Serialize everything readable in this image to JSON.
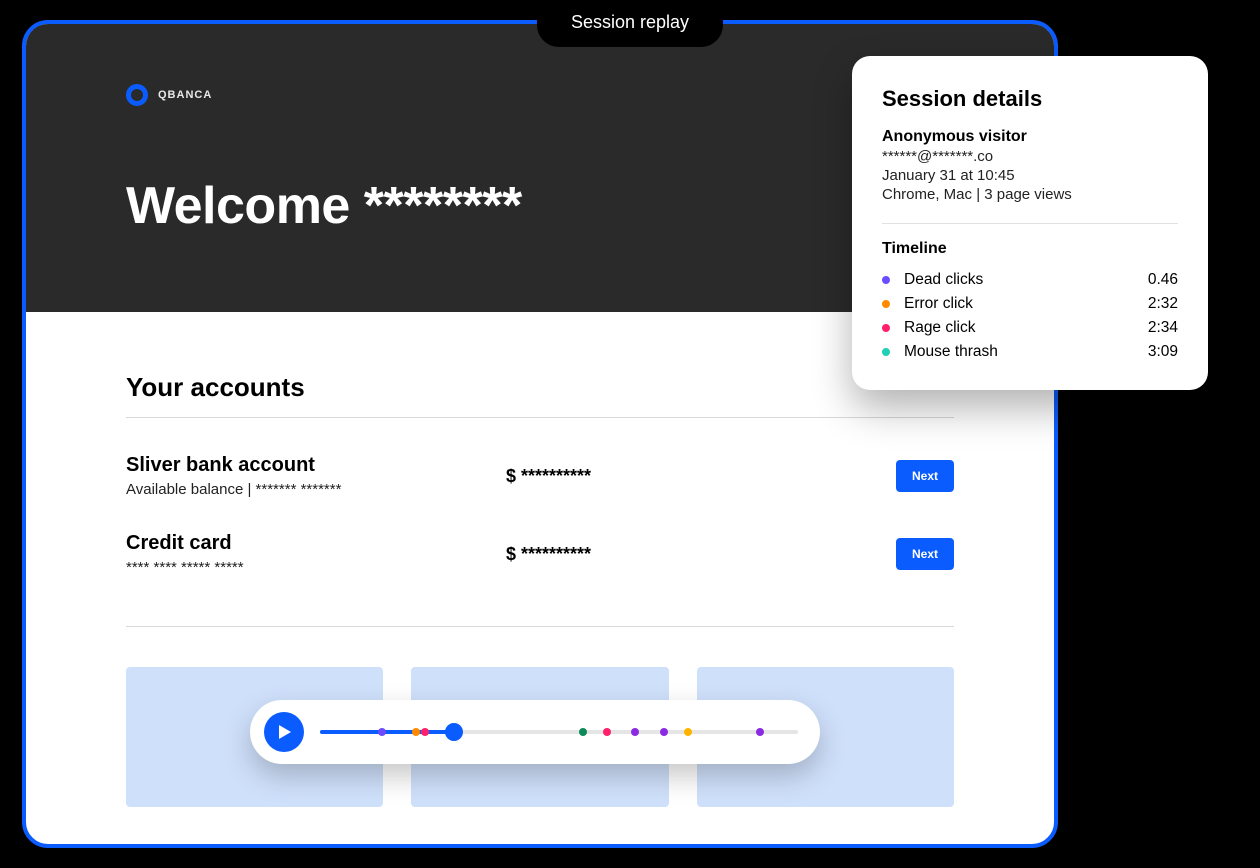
{
  "tab_label": "Session replay",
  "app": {
    "brand": "QBANCA",
    "welcome_text": "Welcome ********"
  },
  "accounts": {
    "section_title": "Your accounts",
    "rows": [
      {
        "name": "Sliver bank account",
        "subline": "Available balance | ******* *******",
        "amount": "$ **********",
        "cta": "Next"
      },
      {
        "name": "Credit card",
        "subline": "**** **** ***** *****",
        "amount": "$ **********",
        "cta": "Next"
      }
    ]
  },
  "session_details": {
    "title": "Session details",
    "visitor": "Anonymous visitor",
    "email": "******@*******.co",
    "datetime": "January 31 at 10:45",
    "client": "Chrome, Mac | 3 page views",
    "timeline_title": "Timeline",
    "timeline": [
      {
        "label": "Dead clicks",
        "time": "0.46",
        "color": "#6b4cff"
      },
      {
        "label": "Error click",
        "time": "2:32",
        "color": "#ff8a00"
      },
      {
        "label": "Rage click",
        "time": "2:34",
        "color": "#ff1f6b"
      },
      {
        "label": "Mouse thrash",
        "time": "3:09",
        "color": "#1fd1b0"
      }
    ]
  },
  "playbar": {
    "progress_pct": 28,
    "markers": [
      {
        "pct": 13,
        "color": "#6b4cff"
      },
      {
        "pct": 20,
        "color": "#ff8a00"
      },
      {
        "pct": 22,
        "color": "#ff1f6b"
      },
      {
        "pct": 55,
        "color": "#0e8a5a"
      },
      {
        "pct": 60,
        "color": "#ff1f6b"
      },
      {
        "pct": 66,
        "color": "#8a2be2"
      },
      {
        "pct": 72,
        "color": "#8a2be2"
      },
      {
        "pct": 77,
        "color": "#ffb400"
      },
      {
        "pct": 92,
        "color": "#8a2be2"
      }
    ]
  }
}
